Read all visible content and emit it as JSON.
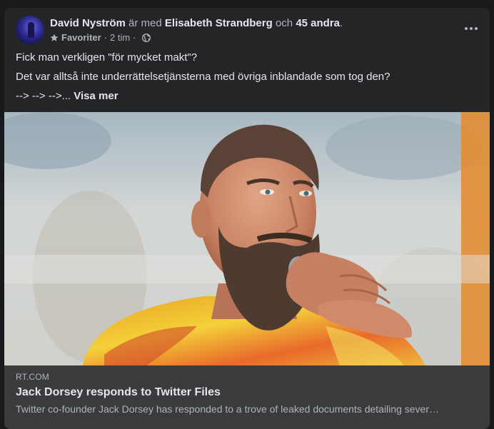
{
  "post": {
    "author": "David Nyström",
    "with_text": "är med",
    "tagged": "Elisabeth Strandberg",
    "and_text": "och",
    "others": "45 andra",
    "period": ".",
    "favorite_label": "Favoriter",
    "dot1": "·",
    "time": "2 tim",
    "dot2": "·",
    "body": [
      "Fick man verkligen \"för mycket makt\"?",
      "Det var alltså inte underrättelsetjänsterna med övriga inblandade som tog den?"
    ],
    "truncated": "--> --> -->...",
    "see_more": "Visa mer"
  },
  "link": {
    "domain": "RT.COM",
    "title": "Jack Dorsey responds to Twitter Files",
    "description": "Twitter co-founder Jack Dorsey has responded to a trove of leaked documents detailing sever…"
  },
  "icons": {
    "more": "more-options-icon",
    "star": "star-icon",
    "globe": "globe-icon"
  },
  "colors": {
    "background": "#18191a",
    "card": "#242526",
    "text_primary": "#e4e6eb",
    "text_secondary": "#b0b3b8",
    "preview_bg": "#3a3b3c"
  }
}
